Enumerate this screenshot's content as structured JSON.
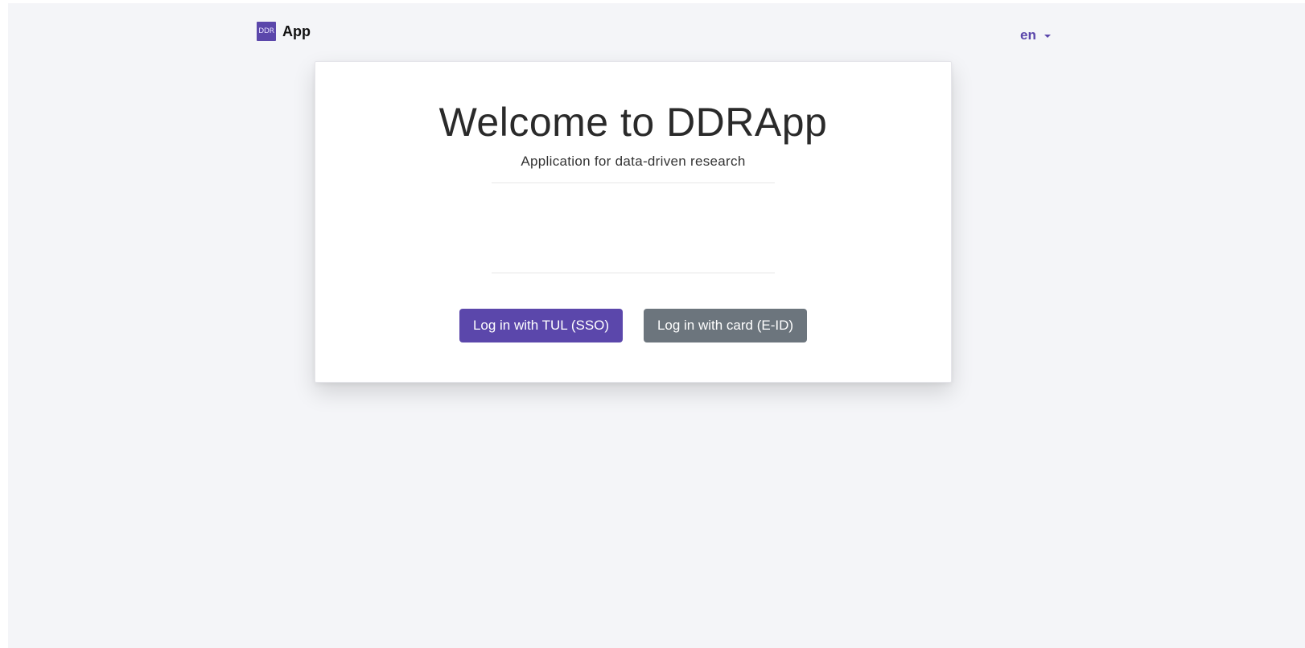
{
  "header": {
    "logo_text": "DDR",
    "app_name": "App",
    "language": "en"
  },
  "card": {
    "title": "Welcome to DDRApp",
    "subtitle": "Application for data-driven research",
    "sso_button_label": "Log in with TUL (SSO)",
    "card_button_label": "Log in with card (E-ID)"
  },
  "colors": {
    "accent": "#5b47ab",
    "secondary": "#6c757d",
    "background": "#f4f5f8"
  },
  "icons": {
    "language_dropdown": "caret-down-icon"
  }
}
